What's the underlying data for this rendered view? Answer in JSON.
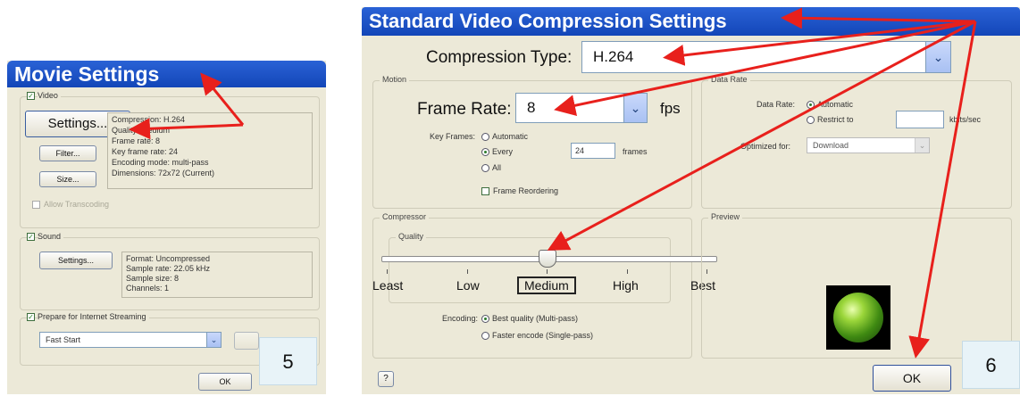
{
  "movie": {
    "title": "Movie Settings",
    "video_label": "Video",
    "settings_btn": "Settings...",
    "filter_btn": "Filter...",
    "size_btn": "Size...",
    "info": [
      "Compression: H.264",
      "Quality: Medium",
      "Frame rate: 8",
      "Key frame rate: 24",
      "Encoding mode: multi-pass",
      "Dimensions: 72x72 (Current)"
    ],
    "allow_transcoding": "Allow Transcoding",
    "sound_label": "Sound",
    "sound_settings_btn": "Settings...",
    "sound_info": [
      "Format: Uncompressed",
      "Sample rate: 22.05 kHz",
      "Sample size: 8",
      "Channels: 1"
    ],
    "prepare_label": "Prepare for Internet Streaming",
    "streaming_value": "Fast Start",
    "ok_btn": "OK",
    "step": "5"
  },
  "compression": {
    "title": "Standard Video Compression Settings",
    "compression_type_label": "Compression Type:",
    "compression_type_value": "H.264",
    "motion_label": "Motion",
    "frame_rate_label": "Frame Rate:",
    "frame_rate_value": "8",
    "fps": "fps",
    "key_frames_label": "Key Frames:",
    "kf_automatic": "Automatic",
    "kf_every": "Every",
    "kf_every_value": "24",
    "kf_frames": "frames",
    "kf_all": "All",
    "frame_reordering": "Frame Reordering",
    "data_rate_group": "Data Rate",
    "data_rate_label": "Data Rate:",
    "dr_automatic": "Automatic",
    "dr_restrict": "Restrict to",
    "dr_units": "kbits/sec",
    "optimized_label": "Optimized for:",
    "optimized_value": "Download",
    "compressor_label": "Compressor",
    "quality_label": "Quality",
    "quality_levels": [
      "Least",
      "Low",
      "Medium",
      "High",
      "Best"
    ],
    "quality_selected": "Medium",
    "encoding_label": "Encoding:",
    "enc_best": "Best quality (Multi-pass)",
    "enc_faster": "Faster encode (Single-pass)",
    "preview_label": "Preview",
    "help_btn": "?",
    "ok_btn": "OK",
    "step": "6"
  },
  "colors": {
    "annotation_arrow": "#e8201c",
    "titlebar": "#1a4fc4",
    "dialog_bg": "#ece9d8"
  }
}
